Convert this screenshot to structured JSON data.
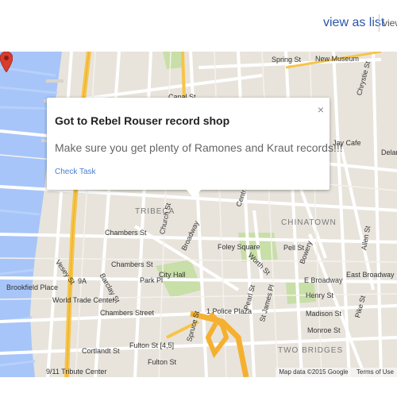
{
  "topbar": {
    "view_as_list": "view as list",
    "view_map": "view"
  },
  "info_window": {
    "title": "Got to Rebel Rouser record shop",
    "description": "Make sure you get plenty of Ramones and Kraut records!!!",
    "link": "Check Task",
    "close": "×"
  },
  "map": {
    "credit": "Map data ©2015 Google",
    "terms": "Terms of Use",
    "neighborhoods": [
      "TRIBECA",
      "CHINATOWN",
      "TWO BRIDGES"
    ],
    "streets": [
      "Spring St",
      "New Museum",
      "Canal St",
      "Chrystie St",
      "Delan",
      "Chambers St",
      "Church St",
      "Broadway",
      "Foley Square",
      "Worth St",
      "Centre St",
      "Pell St",
      "Bowery",
      "Allen St",
      "Vesey St",
      "Barclay St",
      "Park Pl",
      "City Hall",
      "Brookfield Place",
      "World Trade Center",
      "Chambers Street",
      "1 Police Plaza",
      "Pearl St",
      "St James Pl",
      "E Broadway",
      "East Broadway",
      "Henry St",
      "Madison St",
      "Monroe St",
      "Pike St",
      "Cortlandt St",
      "Fulton St",
      "Fulton St [4,5]",
      "Spruce St",
      "9/11 Tribute Center",
      "9A",
      "Jay Cafe"
    ]
  },
  "colors": {
    "link": "#2a56a8",
    "water": "#a7c5f9",
    "land": "#e8e4dc",
    "park": "#c8dfa8",
    "highway": "#f7c448",
    "pin": "#d93b2c"
  },
  "icons": [
    "map-pin-icon",
    "close-icon",
    "subway-icon"
  ]
}
